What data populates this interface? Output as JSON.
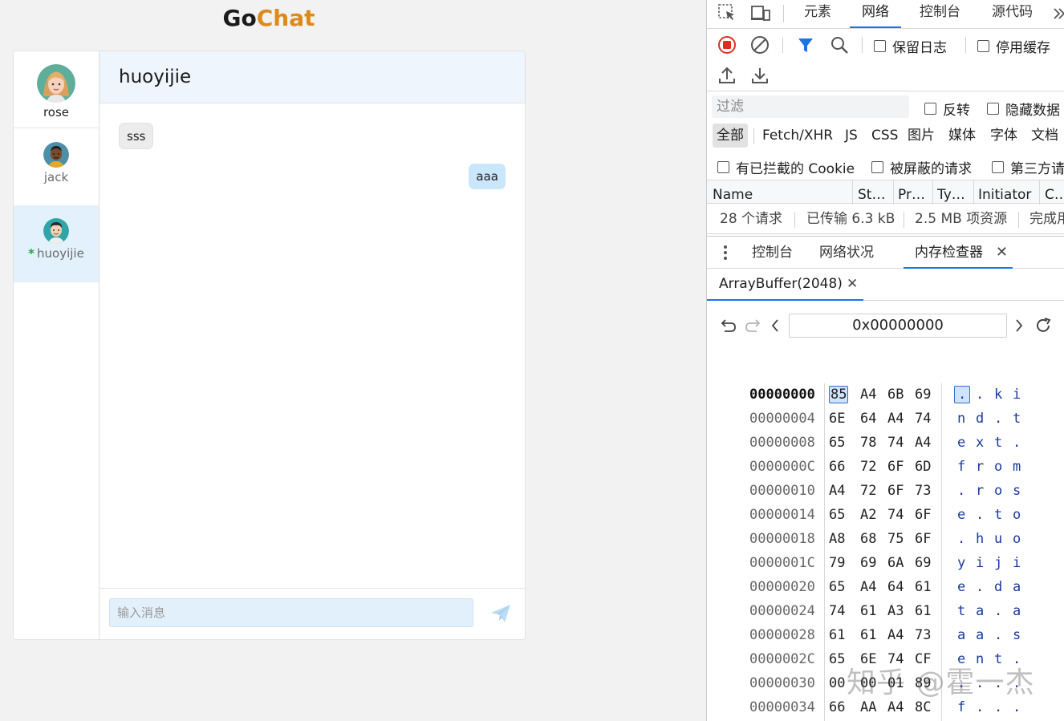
{
  "app": {
    "title_go": "Go",
    "title_chat": "Chat"
  },
  "contacts": [
    {
      "name": "rose",
      "online": false,
      "active": false
    },
    {
      "name": "jack",
      "online": false,
      "active": false
    },
    {
      "name": "huoyijie",
      "online": true,
      "active": true,
      "online_marker": "*"
    }
  ],
  "conversation": {
    "header": "huoyijie",
    "messages": [
      {
        "direction": "received",
        "text": "sss"
      },
      {
        "direction": "sent",
        "text": "aaa"
      }
    ],
    "input_placeholder": "输入消息",
    "send_icon": "paper-plane-icon"
  },
  "devtools": {
    "top_tabs": [
      "元素",
      "网络",
      "控制台",
      "源代码"
    ],
    "top_tab_active": "网络",
    "toolbar": {
      "preserve_log": "保留日志",
      "disable_cache": "停用缓存"
    },
    "filter": {
      "placeholder": "过滤",
      "invert": "反转",
      "hide_data": "隐藏数据"
    },
    "types": [
      "全部",
      "Fetch/XHR",
      "JS",
      "CSS",
      "图片",
      "媒体",
      "字体",
      "文档"
    ],
    "type_active": "全部",
    "cookie_filters": [
      "有已拦截的 Cookie",
      "被屏蔽的请求",
      "第三方请"
    ],
    "table_columns": [
      "Name",
      "St…",
      "Pr…",
      "Ty…",
      "Initiator",
      "C…"
    ],
    "summary": [
      "28 个请求",
      "已传输 6.3 kB",
      "2.5 MB 项资源",
      "完成用"
    ],
    "drawer_tabs": [
      "控制台",
      "网络状况",
      "内存检查器"
    ],
    "drawer_tab_active": "内存检查器",
    "buffer_tab": "ArrayBuffer(2048)",
    "address": "0x00000000",
    "hex_rows": [
      {
        "addr": "00000000",
        "bytes": [
          "85",
          "A4",
          "6B",
          "69"
        ],
        "ascii": [
          ".",
          ".",
          "k",
          "i"
        ]
      },
      {
        "addr": "00000004",
        "bytes": [
          "6E",
          "64",
          "A4",
          "74"
        ],
        "ascii": [
          "n",
          "d",
          ".",
          "t"
        ]
      },
      {
        "addr": "00000008",
        "bytes": [
          "65",
          "78",
          "74",
          "A4"
        ],
        "ascii": [
          "e",
          "x",
          "t",
          "."
        ]
      },
      {
        "addr": "0000000C",
        "bytes": [
          "66",
          "72",
          "6F",
          "6D"
        ],
        "ascii": [
          "f",
          "r",
          "o",
          "m"
        ]
      },
      {
        "addr": "00000010",
        "bytes": [
          "A4",
          "72",
          "6F",
          "73"
        ],
        "ascii": [
          ".",
          "r",
          "o",
          "s"
        ]
      },
      {
        "addr": "00000014",
        "bytes": [
          "65",
          "A2",
          "74",
          "6F"
        ],
        "ascii": [
          "e",
          ".",
          "t",
          "o"
        ]
      },
      {
        "addr": "00000018",
        "bytes": [
          "A8",
          "68",
          "75",
          "6F"
        ],
        "ascii": [
          ".",
          "h",
          "u",
          "o"
        ]
      },
      {
        "addr": "0000001C",
        "bytes": [
          "79",
          "69",
          "6A",
          "69"
        ],
        "ascii": [
          "y",
          "i",
          "j",
          "i"
        ]
      },
      {
        "addr": "00000020",
        "bytes": [
          "65",
          "A4",
          "64",
          "61"
        ],
        "ascii": [
          "e",
          ".",
          "d",
          "a"
        ]
      },
      {
        "addr": "00000024",
        "bytes": [
          "74",
          "61",
          "A3",
          "61"
        ],
        "ascii": [
          "t",
          "a",
          ".",
          "a"
        ]
      },
      {
        "addr": "00000028",
        "bytes": [
          "61",
          "61",
          "A4",
          "73"
        ],
        "ascii": [
          "a",
          "a",
          ".",
          "s"
        ]
      },
      {
        "addr": "0000002C",
        "bytes": [
          "65",
          "6E",
          "74",
          "CF"
        ],
        "ascii": [
          "e",
          "n",
          "t",
          "."
        ]
      },
      {
        "addr": "00000030",
        "bytes": [
          "00",
          "00",
          "01",
          "89"
        ],
        "ascii": [
          ".",
          ".",
          ".",
          "."
        ]
      },
      {
        "addr": "00000034",
        "bytes": [
          "66",
          "AA",
          "A4",
          "8C"
        ],
        "ascii": [
          "f",
          ".",
          ".",
          "."
        ]
      }
    ]
  },
  "watermark": "知乎 @霍一杰"
}
